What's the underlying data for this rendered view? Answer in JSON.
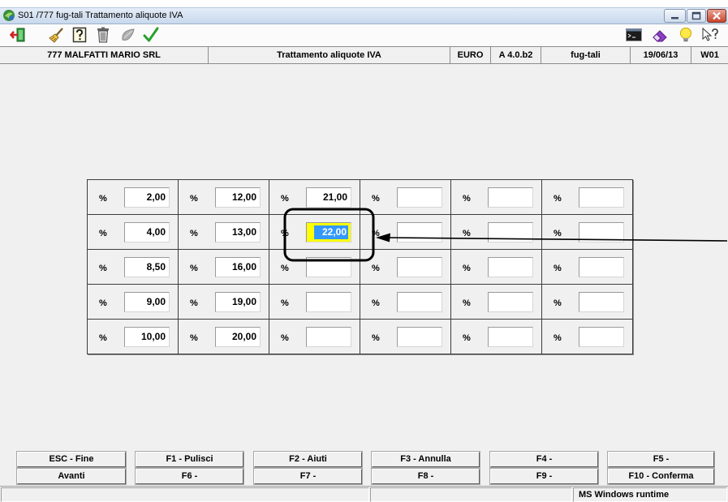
{
  "window": {
    "title": "S01 /777 fug-tali Trattamento aliquote IVA",
    "controls": [
      "minimize-icon",
      "maximize-icon",
      "close-icon"
    ]
  },
  "toolbar": {
    "left_icons": [
      "exit-icon",
      "broom-icon",
      "help-box-icon",
      "trash-icon",
      "brush-icon",
      "check-icon"
    ],
    "right_icons": [
      "terminal-icon",
      "eraser-icon",
      "lightbulb-icon",
      "help-pointer-icon"
    ]
  },
  "header": {
    "company": "777 MALFATTI MARIO SRL",
    "procedure": "Trattamento aliquote IVA",
    "currency": "EURO",
    "version": "A 4.0.b2",
    "program": "fug-tali",
    "date": "19/06/13",
    "workstation": "W01"
  },
  "grid": {
    "percent_symbol": "%",
    "rows": [
      [
        "2,00",
        "12,00",
        "21,00",
        "",
        "",
        ""
      ],
      [
        "4,00",
        "13,00",
        "22,00",
        "",
        "",
        ""
      ],
      [
        "8,50",
        "16,00",
        "",
        "",
        "",
        ""
      ],
      [
        "9,00",
        "19,00",
        "",
        "",
        "",
        ""
      ],
      [
        "10,00",
        "20,00",
        "",
        "",
        "",
        ""
      ]
    ],
    "selected": {
      "row": 1,
      "col": 2
    }
  },
  "function_keys": {
    "row1": [
      "ESC - Fine",
      "F1 - Pulisci",
      "F2 - Aiuti",
      "F3 - Annulla",
      "F4 -",
      "F5 -"
    ],
    "row2": [
      "Avanti",
      "F6 -",
      "F7 -",
      "F8 -",
      "F9 -",
      "F10 - Conferma"
    ]
  },
  "status_bar": {
    "runtime": "MS Windows runtime"
  },
  "colors": {
    "selection": "#3399FF",
    "focus": "#FFFF00",
    "close_button": "#C8452D"
  }
}
